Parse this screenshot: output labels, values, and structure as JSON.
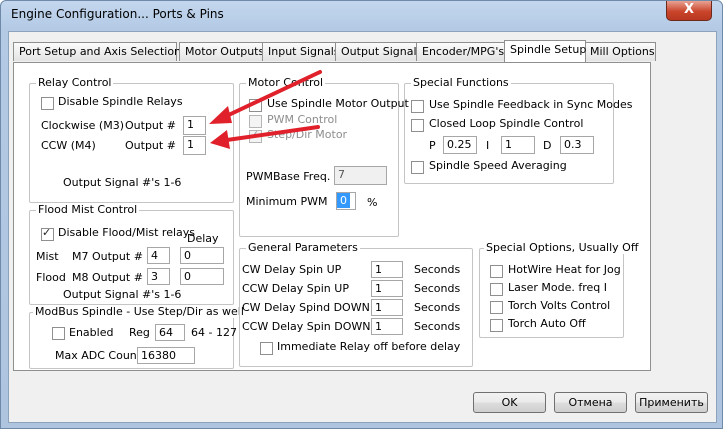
{
  "window": {
    "title": "Engine Configuration... Ports & Pins",
    "close_label": "X"
  },
  "tabs": [
    {
      "label": "Port Setup and Axis Selection"
    },
    {
      "label": "Motor Outputs"
    },
    {
      "label": "Input Signals"
    },
    {
      "label": "Output Signals"
    },
    {
      "label": "Encoder/MPG's"
    },
    {
      "label": "Spindle Setup"
    },
    {
      "label": "Mill Options"
    }
  ],
  "relay": {
    "title": "Relay Control",
    "disable_label": "Disable Spindle Relays",
    "cw_label": "Clockwise (M3)",
    "cw_output_label": "Output #",
    "cw_output_value": "1",
    "ccw_label": "CCW (M4)",
    "ccw_output_label": "Output #",
    "ccw_output_value": "1",
    "note": "Output Signal #'s 1-6"
  },
  "flood": {
    "title": "Flood Mist Control",
    "disable_label": "Disable Flood/Mist relays",
    "delay_label": "Delay",
    "mist_label": "Mist",
    "mist_output_label": "M7 Output #",
    "mist_output_value": "4",
    "mist_delay_value": "0",
    "flood_label": "Flood",
    "flood_output_label": "M8 Output #",
    "flood_output_value": "3",
    "flood_delay_value": "0",
    "note": "Output Signal #'s 1-6"
  },
  "modbus": {
    "title": "ModBus Spindle - Use Step/Dir as well",
    "enabled_label": "Enabled",
    "reg_label": "Reg",
    "reg_value": "64",
    "reg_range": "64 - 127",
    "max_adc_label": "Max ADC Count",
    "max_adc_value": "16380"
  },
  "motor": {
    "title": "Motor Control",
    "use_motor_label": "Use Spindle Motor Output",
    "pwm_label": "PWM Control",
    "stepdir_label": "Step/Dir Motor",
    "pwm_base_label": "PWMBase Freq.",
    "pwm_base_value": "7",
    "min_pwm_label": "Minimum PWM",
    "min_pwm_value": "0",
    "min_pwm_unit": "%"
  },
  "special": {
    "title": "Special Functions",
    "feedback_label": "Use Spindle Feedback in Sync Modes",
    "closed_loop_label": "Closed Loop Spindle Control",
    "p_label": "P",
    "p_value": "0.25",
    "i_label": "I",
    "i_value": "1",
    "d_label": "D",
    "d_value": "0.3",
    "averaging_label": "Spindle Speed Averaging"
  },
  "general": {
    "title": "General Parameters",
    "rows": [
      {
        "label": "CW Delay Spin UP",
        "value": "1",
        "unit": "Seconds"
      },
      {
        "label": "CCW Delay Spin UP",
        "value": "1",
        "unit": "Seconds"
      },
      {
        "label": "CW Delay Spind DOWN",
        "value": "1",
        "unit": "Seconds"
      },
      {
        "label": "CCW Delay Spin DOWN",
        "value": "1",
        "unit": "Seconds"
      }
    ],
    "immediate_label": "Immediate Relay off before delay"
  },
  "options": {
    "title": "Special Options, Usually Off",
    "items": [
      {
        "label": "HotWire Heat for Jog"
      },
      {
        "label": "Laser Mode. freq I"
      },
      {
        "label": "Torch Volts Control"
      },
      {
        "label": "Torch Auto Off"
      }
    ]
  },
  "buttons": {
    "ok": "OK",
    "cancel": "Отмена",
    "apply": "Применить"
  },
  "colors": {
    "arrow": "#e0202a",
    "title_bar": "#b9cfe9",
    "close_button": "#c9462c"
  }
}
